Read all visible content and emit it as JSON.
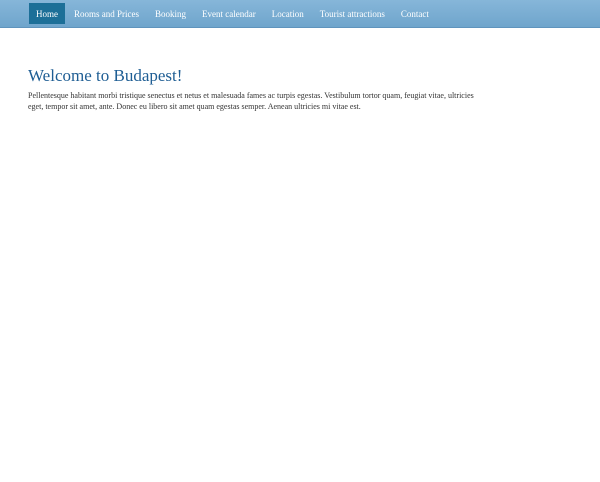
{
  "nav": {
    "items": [
      {
        "label": "Home",
        "active": true
      },
      {
        "label": "Rooms and Prices"
      },
      {
        "label": "Booking"
      },
      {
        "label": "Event calendar"
      },
      {
        "label": "Location"
      },
      {
        "label": "Tourist attractions"
      },
      {
        "label": "Contact"
      }
    ]
  },
  "main": {
    "title": "Welcome to Budapest!",
    "body": "Pellentesque habitant morbi tristique senectus et netus et malesuada fames ac turpis egestas. Vestibulum tortor quam, feugiat vitae, ultricies eget, tempor sit amet, ante. Donec eu libero sit amet quam egestas semper. Aenean ultricies mi vitae est."
  },
  "colors": {
    "navbar": "#78abd0",
    "active_tab": "#1c6f98",
    "title": "#1f5e94"
  }
}
